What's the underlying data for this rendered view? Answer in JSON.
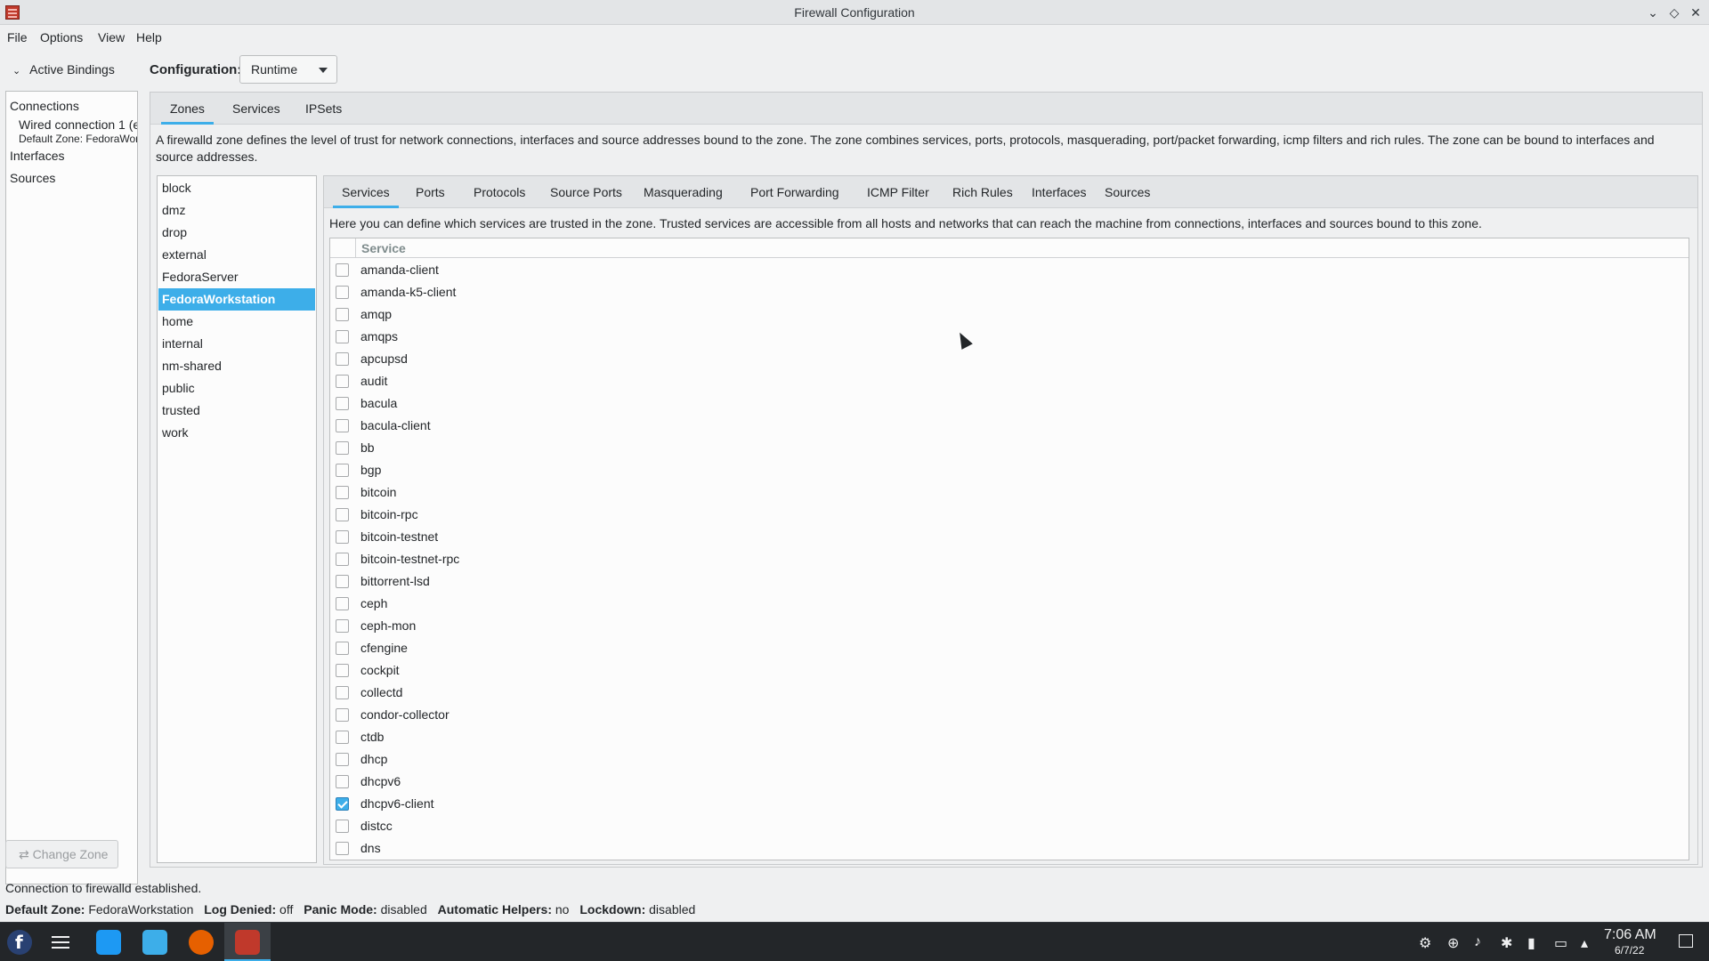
{
  "window": {
    "title": "Firewall Configuration",
    "controls": [
      "minimize",
      "maximize",
      "close"
    ]
  },
  "menubar": [
    "File",
    "Options",
    "View",
    "Help"
  ],
  "left_panel": {
    "header": "Active Bindings",
    "connections_label": "Connections",
    "connection_name": "Wired connection 1 (e",
    "connection_zone": "Default Zone: FedoraWorl",
    "interfaces_label": "Interfaces",
    "sources_label": "Sources",
    "change_zone_button": "Change Zone"
  },
  "configuration": {
    "label": "Configuration:",
    "selected": "Runtime"
  },
  "top_tabs": {
    "items": [
      "Zones",
      "Services",
      "IPSets"
    ],
    "active": "Zones"
  },
  "zone_description": "A firewalld zone defines the level of trust for network connections, interfaces and source addresses bound to the zone. The zone combines services, ports, protocols, masquerading, port/packet forwarding, icmp filters and rich rules. The zone can be bound to interfaces and source addresses.",
  "zones": {
    "items": [
      "block",
      "dmz",
      "drop",
      "external",
      "FedoraServer",
      "FedoraWorkstation",
      "home",
      "internal",
      "nm-shared",
      "public",
      "trusted",
      "work"
    ],
    "selected": "FedoraWorkstation"
  },
  "zone_tabs": {
    "items": [
      "Services",
      "Ports",
      "Protocols",
      "Source Ports",
      "Masquerading",
      "Port Forwarding",
      "ICMP Filter",
      "Rich Rules",
      "Interfaces",
      "Sources"
    ],
    "active": "Services"
  },
  "services_description": "Here you can define which services are trusted in the zone. Trusted services are accessible from all hosts and networks that can reach the machine from connections, interfaces and sources bound to this zone.",
  "services_table": {
    "column_header": "Service",
    "rows": [
      {
        "name": "amanda-client",
        "checked": false
      },
      {
        "name": "amanda-k5-client",
        "checked": false
      },
      {
        "name": "amqp",
        "checked": false
      },
      {
        "name": "amqps",
        "checked": false
      },
      {
        "name": "apcupsd",
        "checked": false
      },
      {
        "name": "audit",
        "checked": false
      },
      {
        "name": "bacula",
        "checked": false
      },
      {
        "name": "bacula-client",
        "checked": false
      },
      {
        "name": "bb",
        "checked": false
      },
      {
        "name": "bgp",
        "checked": false
      },
      {
        "name": "bitcoin",
        "checked": false
      },
      {
        "name": "bitcoin-rpc",
        "checked": false
      },
      {
        "name": "bitcoin-testnet",
        "checked": false
      },
      {
        "name": "bitcoin-testnet-rpc",
        "checked": false
      },
      {
        "name": "bittorrent-lsd",
        "checked": false
      },
      {
        "name": "ceph",
        "checked": false
      },
      {
        "name": "ceph-mon",
        "checked": false
      },
      {
        "name": "cfengine",
        "checked": false
      },
      {
        "name": "cockpit",
        "checked": false
      },
      {
        "name": "collectd",
        "checked": false
      },
      {
        "name": "condor-collector",
        "checked": false
      },
      {
        "name": "ctdb",
        "checked": false
      },
      {
        "name": "dhcp",
        "checked": false
      },
      {
        "name": "dhcpv6",
        "checked": false
      },
      {
        "name": "dhcpv6-client",
        "checked": true
      },
      {
        "name": "distcc",
        "checked": false
      },
      {
        "name": "dns",
        "checked": false
      }
    ]
  },
  "status": {
    "message": "Connection to firewalld established.",
    "default_zone_label": "Default Zone:",
    "default_zone_value": "FedoraWorkstation",
    "log_denied_label": "Log Denied:",
    "log_denied_value": "off",
    "panic_mode_label": "Panic Mode:",
    "panic_mode_value": "disabled",
    "automatic_helpers_label": "Automatic Helpers:",
    "automatic_helpers_value": "no",
    "lockdown_label": "Lockdown:",
    "lockdown_value": "disabled"
  },
  "taskbar": {
    "apps": [
      "fedora-launcher-icon",
      "settings-icon",
      "software-store-icon",
      "file-manager-icon",
      "firefox-icon",
      "firewall-config-icon"
    ],
    "tray": [
      "network-share-icon",
      "updates-icon",
      "volume-icon",
      "bluetooth-icon",
      "storage-icon",
      "network-icon",
      "tray-expand-icon"
    ],
    "time": "7:06 AM",
    "date": "6/7/22"
  },
  "colors": {
    "accent": "#3daee9",
    "selected_text": "#ffffff",
    "taskbar": "#232629"
  }
}
